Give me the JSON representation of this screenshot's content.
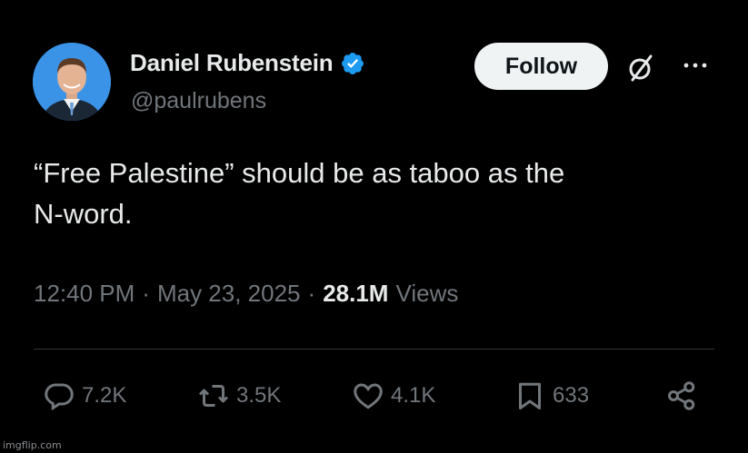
{
  "author": {
    "name": "Daniel Rubenstein",
    "handle": "@paulrubens",
    "verified": true
  },
  "header": {
    "follow_label": "Follow",
    "grok_icon": "slashed-circle-icon",
    "more_icon": "more-dots-icon"
  },
  "tweet": {
    "line1": "“Free Palestine” should be as taboo as the",
    "line2": "N-word."
  },
  "meta": {
    "time": "12:40 PM",
    "date": "May 23, 2025",
    "views_count": "28.1M",
    "views_label": "Views",
    "separator": "·"
  },
  "actions": {
    "replies": "7.2K",
    "reposts": "3.5K",
    "likes": "4.1K",
    "bookmarks": "633"
  },
  "watermark": "imgflip.com",
  "colors": {
    "background": "#000000",
    "text": "#e7e9ea",
    "muted": "#71767b",
    "verified": "#1d9bf0",
    "follow_bg": "#eff3f4"
  }
}
